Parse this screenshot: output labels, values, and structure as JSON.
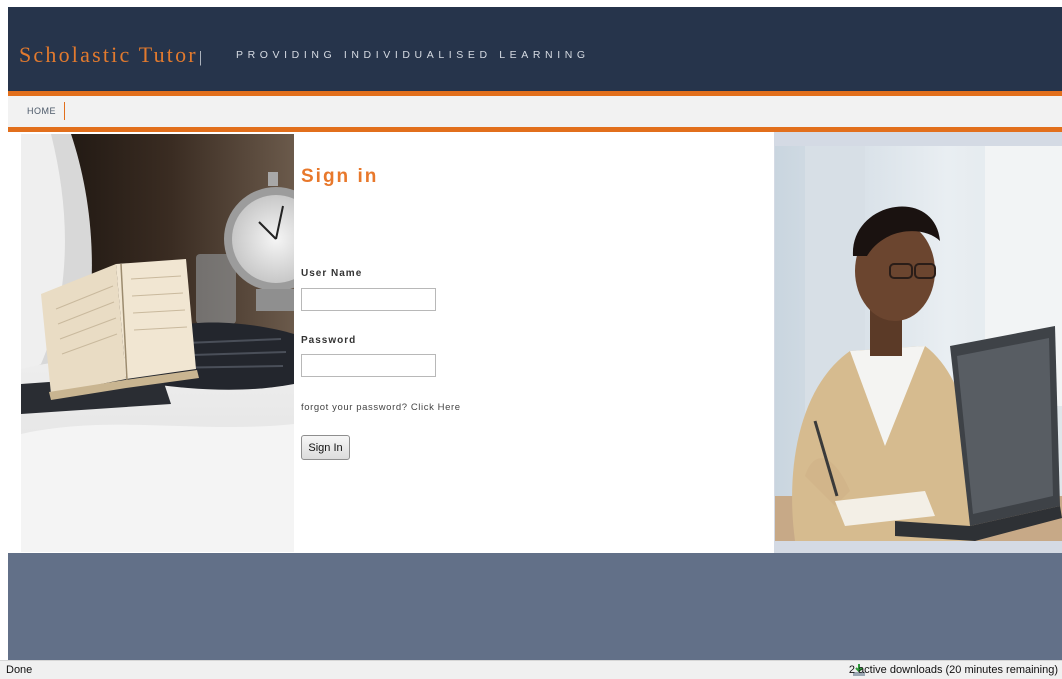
{
  "header": {
    "logo_text": "Scholastic Tutor",
    "logo_separator": "|",
    "tagline": "PROVIDING INDIVIDUALISED LEARNING"
  },
  "nav": {
    "items": [
      {
        "label": "HOME"
      }
    ]
  },
  "signin": {
    "title": "Sign in",
    "username_label": "User Name",
    "username_value": "",
    "password_label": "Password",
    "password_value": "",
    "forgot_prefix": "forgot your password?",
    "forgot_link": "Click Here",
    "button_label": "Sign In"
  },
  "statusbar": {
    "left_text": "Done",
    "downloads_text": "2 active downloads (20 minutes remaining)",
    "downloads_icon": "download-arrow-icon"
  },
  "colors": {
    "header_bg": "#26344b",
    "accent_orange": "#e26f1c",
    "footer_band": "#627088",
    "right_panel": "#d4dae4"
  }
}
